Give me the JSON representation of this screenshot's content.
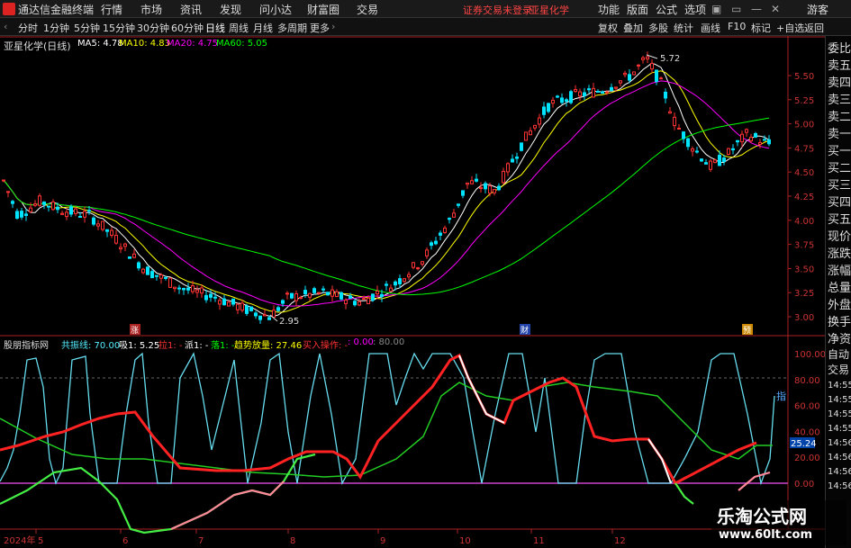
{
  "titlebar": {
    "app_name": "通达信金融终端",
    "menu": [
      "行情",
      "市场",
      "资讯",
      "发现",
      "问小达",
      "财富圈",
      "交易"
    ],
    "status_text": "证券交易未登录",
    "stock_name": "亚星化学",
    "right_menu": [
      "功能",
      "版面",
      "公式",
      "选项"
    ],
    "guest_label": "游客"
  },
  "periodbar": {
    "periods": [
      "分时",
      "1分钟",
      "5分钟",
      "15分钟",
      "30分钟",
      "60分钟",
      "日线",
      "周线",
      "月线",
      "多周期",
      "更多"
    ],
    "active_period": "日线",
    "tools": [
      "复权",
      "叠加",
      "多股",
      "统计",
      "画线",
      "F10",
      "标记",
      "+自选",
      "返回"
    ]
  },
  "right_panel": [
    "委比",
    "卖五",
    "卖四",
    "卖三",
    "卖二",
    "卖一",
    "买一",
    "买二",
    "买三",
    "买四",
    "买五",
    "现价",
    "涨跌",
    "涨幅",
    "总量",
    "外盘",
    "换手",
    "净资",
    "收益"
  ],
  "right_panel_bottom": [
    "自动",
    "交易"
  ],
  "main_chart": {
    "title": "亚星化学(日线)",
    "ma_labels": [
      {
        "text": "MA5: 4.78",
        "color": "#ffffff"
      },
      {
        "text": "MA10: 4.83",
        "color": "#ffff00"
      },
      {
        "text": "MA20: 4.75",
        "color": "#ff00ff"
      },
      {
        "text": "MA60: 5.05",
        "color": "#00ff00"
      }
    ],
    "price_ticks": [
      "5.50",
      "5.25",
      "5.00",
      "4.75",
      "4.50",
      "4.25",
      "4.00",
      "3.75",
      "3.50",
      "3.25",
      "3.00"
    ],
    "high_label": "5.72",
    "low_label": "2.95",
    "markers": [
      "涨",
      "财",
      "预"
    ]
  },
  "indicator": {
    "name": "股朋指标网",
    "params": [
      {
        "text": "共振线: 70.00",
        "color": "#55eeff"
      },
      {
        "text": "吸1: 5.25",
        "color": "#ffffff"
      },
      {
        "text": "拉1: -",
        "color": "#ff3333"
      },
      {
        "text": "派1: -",
        "color": "#ffffff"
      },
      {
        "text": "落1: -",
        "color": "#00ff00"
      },
      {
        "text": "趋势放量: 27.46",
        "color": "#ffff00"
      },
      {
        "text": "买入操作: -",
        "color": "#ff3333"
      },
      {
        "text": ": 0.00",
        "color": "#ff00ff"
      },
      {
        "text": ": 80.00",
        "color": "#888888"
      }
    ],
    "ticks": [
      "100.00",
      "80.00",
      "60.00",
      "40.00",
      "20.00",
      "0.00"
    ],
    "current_value": "25.24",
    "side_label": "指",
    "time_labels": [
      "14:55",
      "14:55",
      "14:55",
      "14:55",
      "14:56",
      "14:56",
      "14:56",
      "14:56"
    ]
  },
  "x_axis": [
    "2024年",
    "5",
    "6",
    "7",
    "8",
    "9",
    "10",
    "11",
    "12"
  ],
  "watermark": {
    "title": "乐淘公式网",
    "url": "www.60lt.com"
  }
}
